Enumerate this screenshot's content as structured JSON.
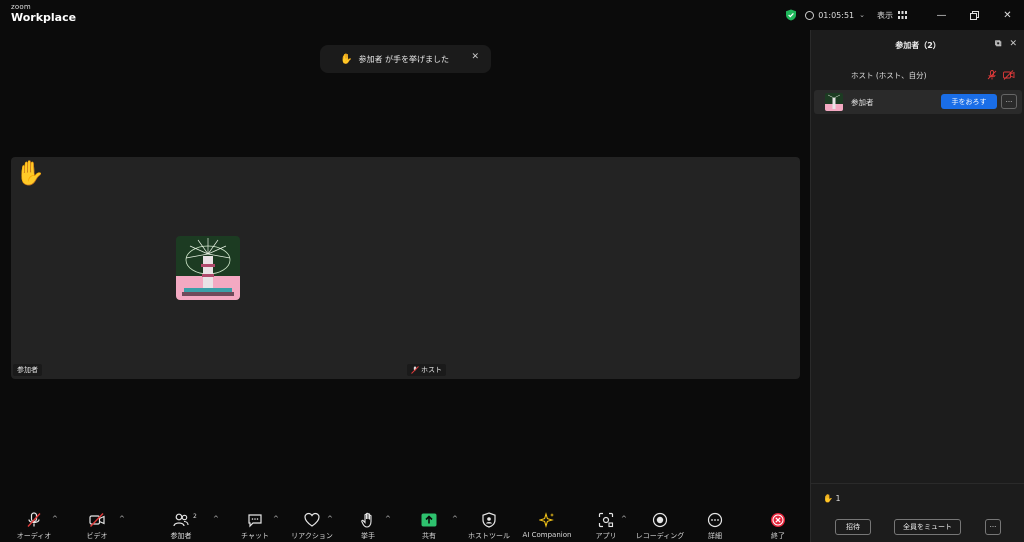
{
  "app": {
    "brand": "zoom",
    "product": "Workplace"
  },
  "titlebar": {
    "timer": "01:05:51",
    "view_label": "表示"
  },
  "notification": {
    "text": "参加者 が手を挙げました"
  },
  "video": {
    "participant_name": "参加者",
    "host_name": "ホスト"
  },
  "participants_panel": {
    "title": "参加者（2）",
    "host_label": "ホスト (ホスト、自分)",
    "participant_label": "参加者",
    "lower_hand_button": "手をおろす",
    "more_label": "···",
    "raised_count": "1",
    "invite_button": "招待",
    "mute_all_button": "全員をミュート"
  },
  "toolbar": {
    "audio": "オーディオ",
    "video": "ビデオ",
    "participants": "参加者",
    "participants_count": "2",
    "chat": "チャット",
    "reactions": "リアクション",
    "raise_hand": "挙手",
    "share": "共有",
    "host_tools": "ホストツール",
    "ai_companion": "AI Companion",
    "apps": "アプリ",
    "recording": "レコーディング",
    "more": "詳細",
    "end": "終了"
  },
  "colors": {
    "accent_blue": "#1a6ee8",
    "share_green": "#2ec26e",
    "end_red": "#e5243b",
    "mute_red": "#e03a3a",
    "shield_green": "#1fb65a",
    "ai_gold": "#f5c518"
  }
}
